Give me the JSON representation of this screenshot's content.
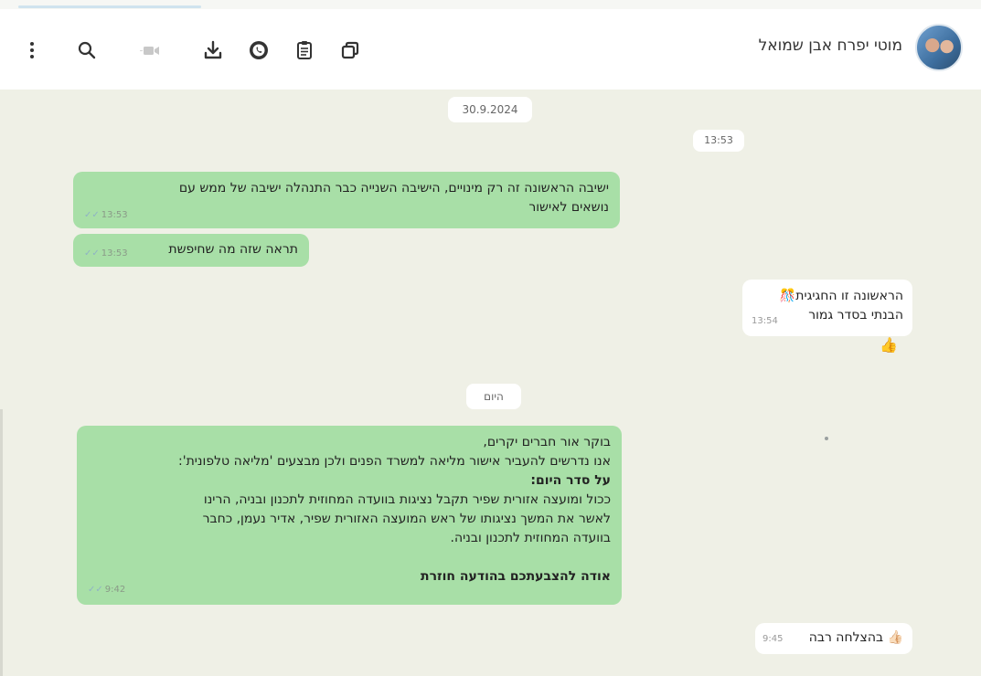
{
  "header": {
    "contact_name": "מוטי יפרח אבן שמואל",
    "icons": [
      "more-vertical-icon",
      "search-icon",
      "video-call-icon",
      "download-icon",
      "whatsapp-icon",
      "clipboard-icon",
      "copy-icon"
    ]
  },
  "chat": {
    "date_chip_1": "30.9.2024",
    "time_chip_1": "13:53",
    "date_chip_2": "היום",
    "messages": [
      {
        "direction": "out",
        "lines": [
          "ישיבה הראשונה זה רק מינויים, הישיבה השנייה כבר התנהלה ישיבה של ממש עם",
          "נושאים לאישור"
        ],
        "time": "13:53"
      },
      {
        "direction": "out",
        "lines": [
          "תראה שזה מה שחיפשת"
        ],
        "time": "13:53"
      },
      {
        "direction": "in",
        "lines": [
          "הראשונה זו החגיגית🎊",
          "הבנתי בסדר גמור"
        ],
        "time": "13:54",
        "reaction": "👍"
      },
      {
        "direction": "out",
        "lines": [
          "בוקר אור חברים יקרים,",
          "אנו נדרשים להעביר אישור מליאה למשרד הפנים ולכן מבצעים 'מליאה טלפונית':",
          "על סדר היום:",
          "ככול ומועצה אזורית שפיר תקבל נציגות בוועדה המחוזית לתכנון ובניה, הרינו",
          "לאשר את המשך נציגותו של ראש המועצה האזורית שפיר, אדיר נעמן, כחבר",
          "בוועדה המחוזית לתכנון ובניה.",
          "אודה להצבעתכם בהודעה חוזרת"
        ],
        "time": "9:42"
      },
      {
        "direction": "in",
        "lines": [
          "👍🏻 בהצלחה רבה"
        ],
        "time": "9:45"
      }
    ]
  },
  "colors": {
    "chat_bg": "#eff0e6",
    "outgoing_bubble": "#a8dfa7",
    "incoming_bubble": "#ffffff"
  }
}
